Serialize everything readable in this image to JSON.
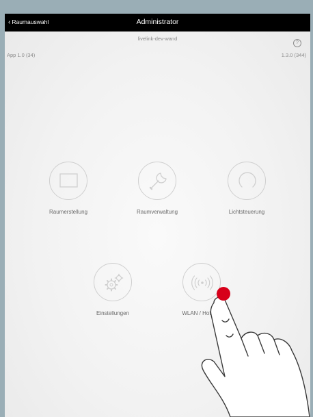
{
  "nav": {
    "back_label": "Raumauswahl",
    "title": "Administrator"
  },
  "header": {
    "device_name": "livelink-dev-wand",
    "app_version": "App 1.0 (34)",
    "firmware_version": "1.3.0 (344)",
    "help_glyph": "?"
  },
  "tiles": [
    {
      "label": "Raumerstellung",
      "icon": "screen-icon"
    },
    {
      "label": "Raumverwaltung",
      "icon": "wrench-icon"
    },
    {
      "label": "Lichtsteuerung",
      "icon": "dimmer-ring-icon"
    },
    {
      "label": "Einstellungen",
      "icon": "gears-icon"
    },
    {
      "label": "WLAN / Hotspot",
      "icon": "wifi-broadcast-icon"
    }
  ],
  "colors": {
    "topbar": "#000000",
    "tap_indicator": "#d7001a",
    "icon_stroke": "#cfcfcf",
    "outer_frame": "#9aaeb6"
  }
}
